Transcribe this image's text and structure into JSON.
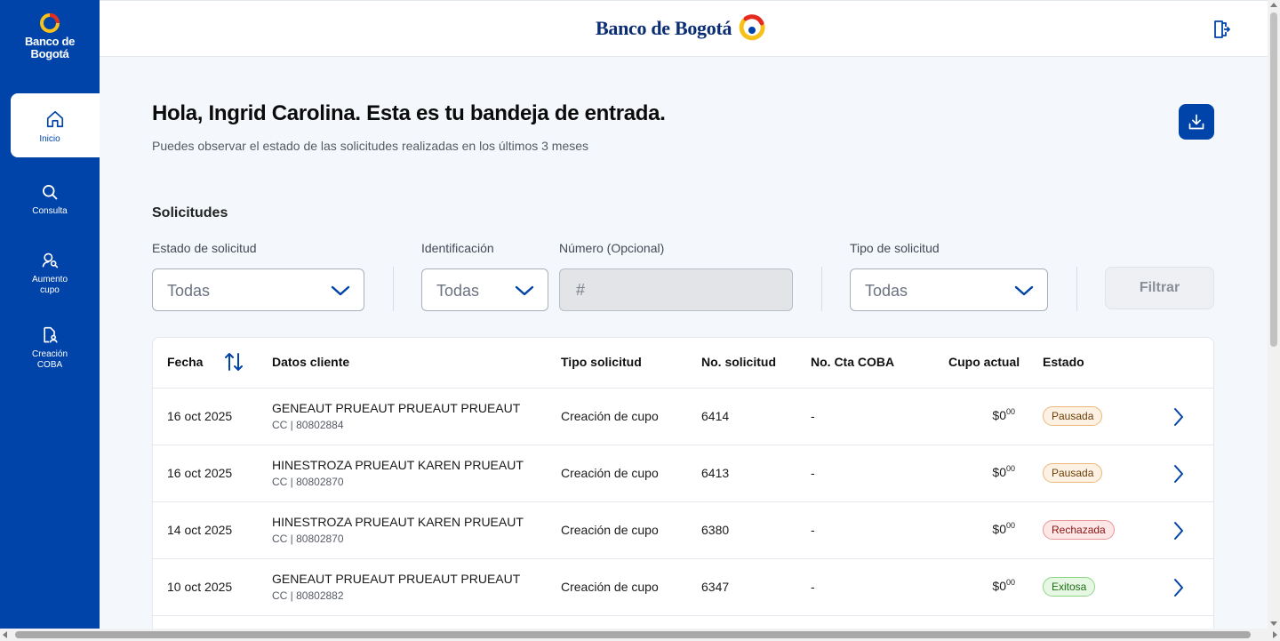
{
  "brand": {
    "sidebar_logo_line1": "Banco de",
    "sidebar_logo_line2": "Bogotá",
    "header_name": "Banco de Bogotá"
  },
  "nav": {
    "items": [
      {
        "label": "Inicio",
        "icon": "home-icon",
        "active": true
      },
      {
        "label": "Consulta",
        "icon": "search-icon"
      },
      {
        "label_line1": "Aumento",
        "label_line2": "cupo",
        "icon": "user-search-icon"
      },
      {
        "label_line1": "Creación",
        "label_line2": "COBA",
        "icon": "document-user-icon"
      }
    ]
  },
  "page": {
    "greeting": "Hola, Ingrid Carolina.  Esta es tu bandeja de entrada.",
    "subtitle": "Puedes observar el estado de las solicitudes realizadas en los últimos 3 meses",
    "section_title": "Solicitudes"
  },
  "filters": {
    "estado_label": "Estado de solicitud",
    "estado_value": "Todas",
    "identificacion_label": "Identificación",
    "identificacion_value": "Todas",
    "numero_label": "Número (Opcional)",
    "numero_placeholder": "#",
    "tipo_label": "Tipo de solicitud",
    "tipo_value": "Todas",
    "filter_button": "Filtrar"
  },
  "table": {
    "headers": {
      "fecha": "Fecha",
      "datos": "Datos cliente",
      "tipo": "Tipo solicitud",
      "nro": "No. solicitud",
      "cta": "No. Cta COBA",
      "cupo": "Cupo actual",
      "estado": "Estado"
    },
    "rows": [
      {
        "fecha": "16 oct 2025",
        "nombre": "GENEAUT PRUEAUT PRUEAUT PRUEAUT",
        "id": "CC | 80802884",
        "tipo": "Creación de cupo",
        "nro": "6414",
        "cta": "-",
        "cupo_int": "$0",
        "cupo_dec": "00",
        "estado": "Pausada"
      },
      {
        "fecha": "16 oct 2025",
        "nombre": "HINESTROZA PRUEAUT KAREN PRUEAUT",
        "id": "CC | 80802870",
        "tipo": "Creación de cupo",
        "nro": "6413",
        "cta": "-",
        "cupo_int": "$0",
        "cupo_dec": "00",
        "estado": "Pausada"
      },
      {
        "fecha": "14 oct 2025",
        "nombre": "HINESTROZA PRUEAUT KAREN PRUEAUT",
        "id": "CC | 80802870",
        "tipo": "Creación de cupo",
        "nro": "6380",
        "cta": "-",
        "cupo_int": "$0",
        "cupo_dec": "00",
        "estado": "Rechazada"
      },
      {
        "fecha": "10 oct 2025",
        "nombre": "GENEAUT PRUEAUT PRUEAUT PRUEAUT",
        "id": "CC | 80802882",
        "tipo": "Creación de cupo",
        "nro": "6347",
        "cta": "-",
        "cupo_int": "$0",
        "cupo_dec": "00",
        "estado": "Exitosa"
      }
    ]
  },
  "colors": {
    "primary": "#0043a9",
    "background": "#f4f7fc",
    "pausada": "#fdf1e3",
    "rechazada": "#fde6e6",
    "exitosa": "#e6f8e4"
  }
}
